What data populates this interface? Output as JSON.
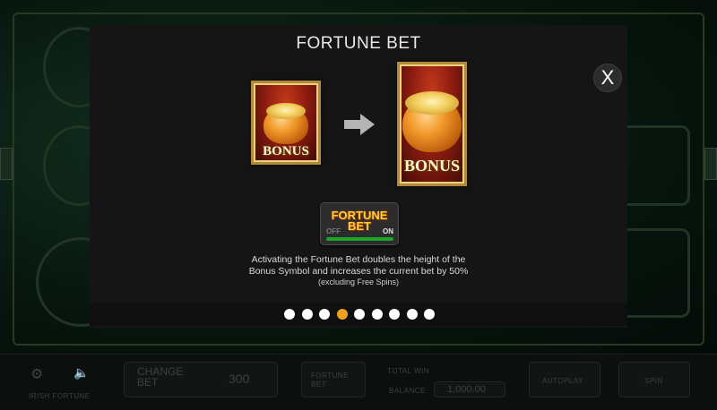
{
  "modal": {
    "title": "FORTUNE BET",
    "close_label": "X",
    "card_small_label": "BONUS",
    "card_large_label": "BONUS",
    "toggle": {
      "line1": "FORTUNE",
      "line2": "BET",
      "off_label": "OFF",
      "on_label": "ON",
      "state": "on"
    },
    "description": {
      "line1": "Activating the Fortune Bet doubles the height of the",
      "line2": "Bonus Symbol and increases the current bet by 50%",
      "line3": "(excluding Free Spins)"
    },
    "pagination": {
      "total": 9,
      "active_index": 3
    }
  },
  "bottom_bar": {
    "game_name": "IRISH FORTUNE",
    "change_bet_label": "CHANGE\nBET",
    "bet_value": "300",
    "fortune_bet_label": "FORTUNE\nBET",
    "total_win_label": "TOTAL WIN",
    "balance_label": "BALANCE",
    "balance_value": "1,000.00",
    "autoplay_label": "AUTOPLAY",
    "spin_label": "SPIN"
  },
  "colors": {
    "accent_dot": "#f0a020",
    "toggle_on_bar": "#1aa82a",
    "title_text": "#e8e8e8"
  }
}
